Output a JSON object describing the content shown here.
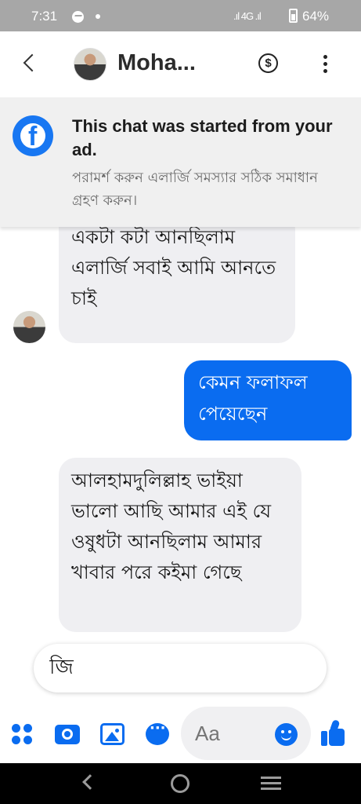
{
  "status_bar": {
    "time": "7:31",
    "network": ".ıl 4G .ıl",
    "battery": "64%"
  },
  "header": {
    "contact_name": "Moha...",
    "payment_symbol": "$"
  },
  "ad_banner": {
    "title": "This chat was started from your ad.",
    "subtitle": "পরামর্শ করুন এলার্জি সমস্যার সঠিক সমাধান গ্রহণ করুন।"
  },
  "messages": [
    {
      "direction": "incoming",
      "text": "একটা কটা আনছিলাম এলার্জি সবাই আমি আনতে চাই"
    },
    {
      "direction": "outgoing",
      "text": "কেমন ফলাফল পেয়েছেন"
    },
    {
      "direction": "incoming",
      "text": "আলহামদুলিল্লাহ ভাইয়া ভালো আছি আমার এই যে ওষুধটা আনছিলাম আমার খাবার পরে কইমা গেছে"
    }
  ],
  "reply_input": {
    "value": "জি"
  },
  "composer": {
    "placeholder": "Aa",
    "accent_color": "#0a6cf0"
  }
}
